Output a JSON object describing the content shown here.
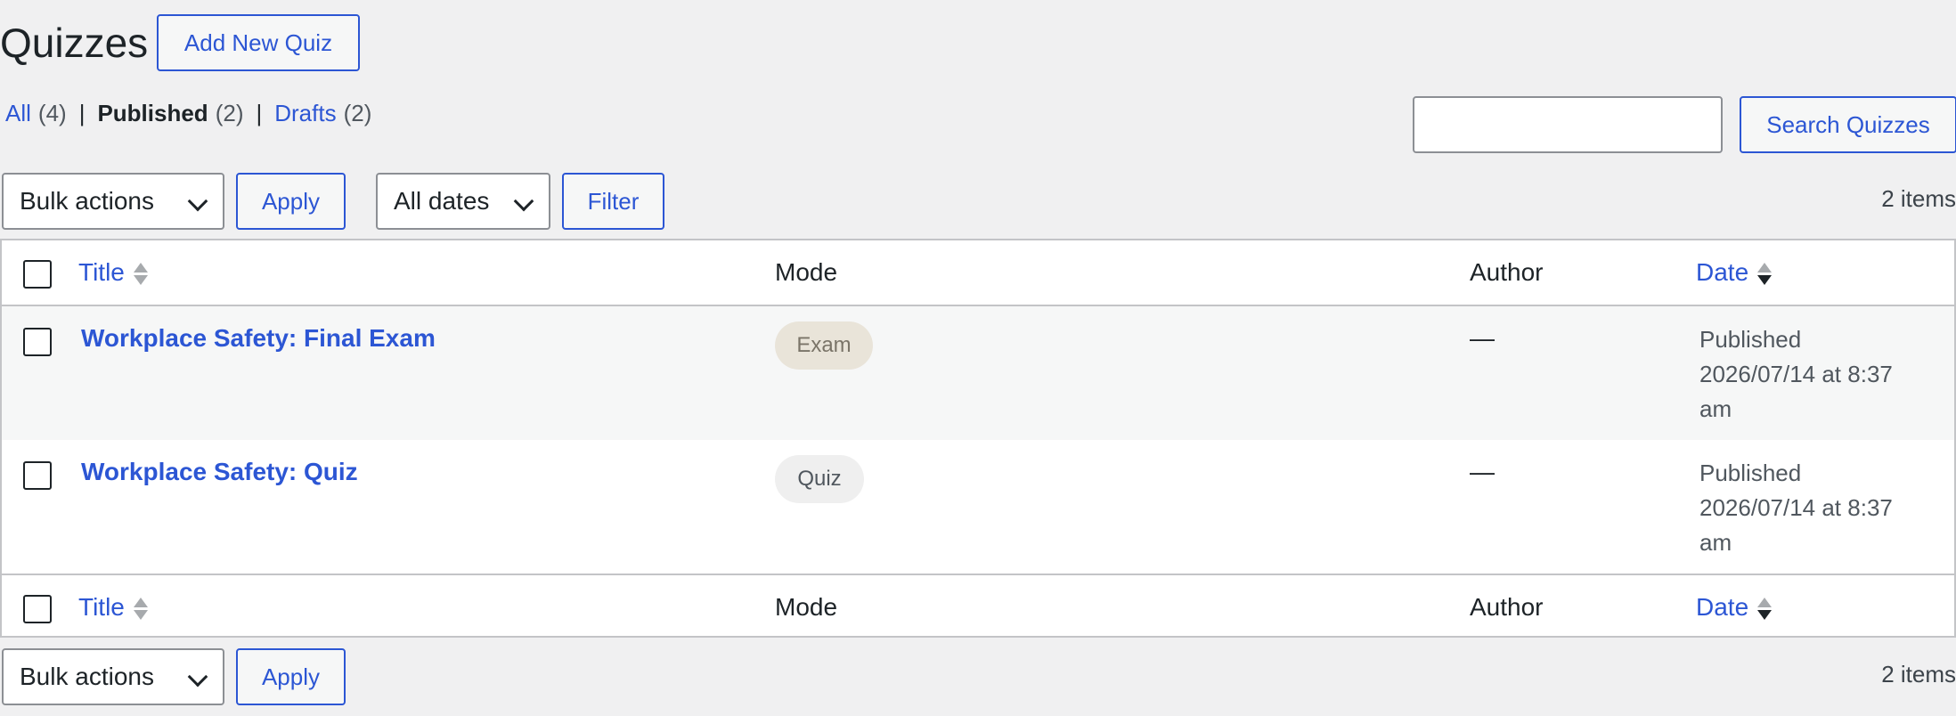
{
  "header": {
    "title": "Quizzes",
    "add_new_label": "Add New Quiz"
  },
  "views": {
    "all_label": "All",
    "all_count": "(4)",
    "published_label": "Published",
    "published_count": "(2)",
    "drafts_label": "Drafts",
    "drafts_count": "(2)",
    "separator": "|"
  },
  "search": {
    "value": "",
    "button_label": "Search Quizzes"
  },
  "tablenav_top": {
    "bulk_actions": "Bulk actions",
    "apply_label": "Apply",
    "dates_filter": "All dates",
    "filter_label": "Filter",
    "items_count": "2 items"
  },
  "table": {
    "columns": {
      "title": "Title",
      "mode": "Mode",
      "author": "Author",
      "date": "Date"
    },
    "rows": [
      {
        "title": "Workplace Safety: Final Exam",
        "mode": "Exam",
        "author": "—",
        "date_status": "Published",
        "date_value": "2026/07/14 at 8:37 am"
      },
      {
        "title": "Workplace Safety: Quiz",
        "mode": "Quiz",
        "author": "—",
        "date_status": "Published",
        "date_value": "2026/07/14 at 8:37 am"
      }
    ]
  },
  "tablenav_bottom": {
    "bulk_actions": "Bulk actions",
    "apply_label": "Apply",
    "items_count": "2 items"
  },
  "colors": {
    "link": "#2c56d4",
    "background": "#f0f0f1",
    "exam_badge_bg": "#e9e4d9",
    "quiz_badge_bg": "#efefef"
  }
}
